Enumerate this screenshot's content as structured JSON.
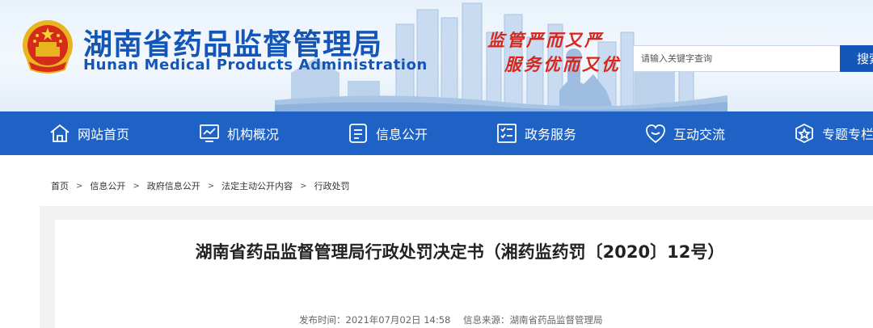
{
  "header": {
    "title": "湖南省药品监督管理局",
    "subtitle": "Hunan Medical Products Administration",
    "slogan_line1": "监管严而又严",
    "slogan_line2": "服务优而又优",
    "search": {
      "placeholder": "请输入关键字查询",
      "button_label": "搜索"
    }
  },
  "nav": {
    "items": [
      {
        "label": "网站首页",
        "icon": "home-icon"
      },
      {
        "label": "机构概况",
        "icon": "chart-icon"
      },
      {
        "label": "信息公开",
        "icon": "info-icon"
      },
      {
        "label": "政务服务",
        "icon": "checklist-icon"
      },
      {
        "label": "互动交流",
        "icon": "heart-chat-icon"
      },
      {
        "label": "专题专栏",
        "icon": "star-icon"
      }
    ]
  },
  "breadcrumb": {
    "items": [
      "首页",
      "信息公开",
      "政府信息公开",
      "法定主动公开内容",
      "行政处罚"
    ],
    "separator": ">"
  },
  "article": {
    "title": "湖南省药品监督管理局行政处罚决定书（湘药监药罚〔2020〕12号）",
    "publish_label": "发布时间：2021年07月02日 14:58",
    "source_label": "信息来源：湖南省药品监督管理局"
  },
  "colors": {
    "brand_blue": "#1455b8",
    "nav_blue": "#1e62c6",
    "slogan_red": "#d8261c"
  }
}
